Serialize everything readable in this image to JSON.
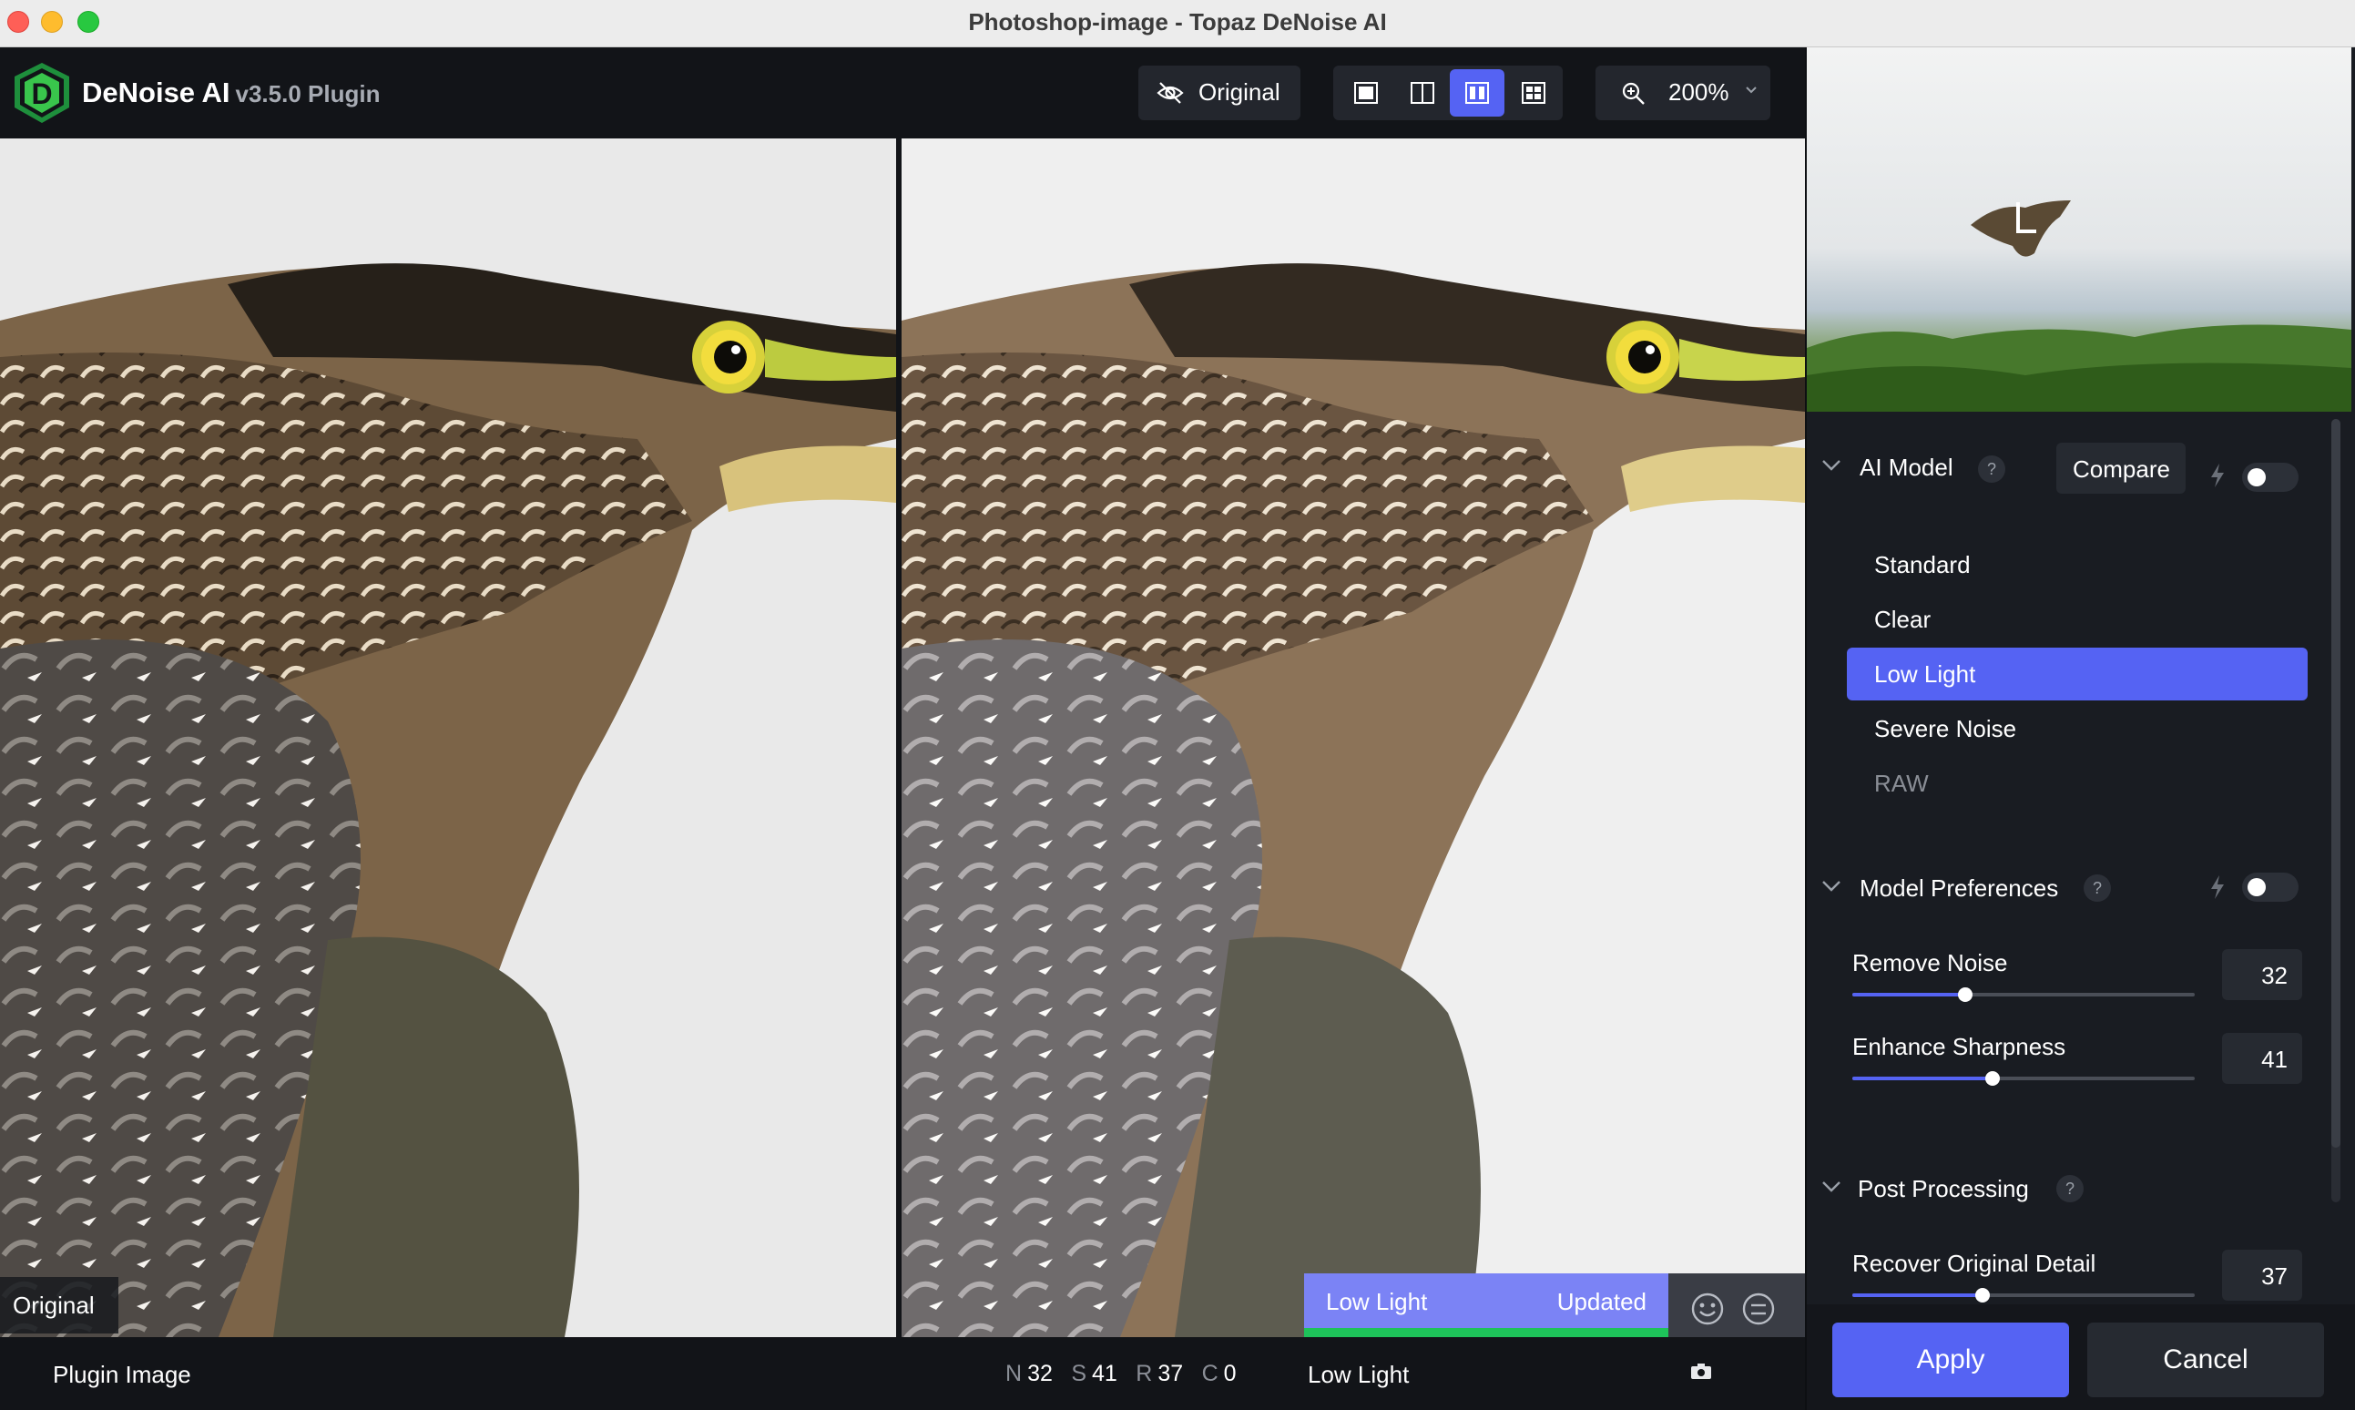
{
  "window": {
    "title": "Photoshop-image - Topaz DeNoise AI"
  },
  "app": {
    "name": "DeNoise AI",
    "version": "v3.5.0 Plugin"
  },
  "toolbar": {
    "original_label": "Original",
    "zoom_label": "200%",
    "view_modes": [
      "single-view",
      "split-view",
      "side-by-side-view",
      "comparison-grid-view"
    ],
    "active_view": "side-by-side-view"
  },
  "preview": {
    "original_tag": "Original",
    "model_name": "Low Light",
    "model_state": "Updated"
  },
  "statusbar": {
    "plugin_image": "Plugin Image",
    "stats": [
      {
        "key": "N",
        "value": "32"
      },
      {
        "key": "S",
        "value": "41"
      },
      {
        "key": "R",
        "value": "37"
      },
      {
        "key": "C",
        "value": "0"
      }
    ],
    "model": "Low Light"
  },
  "ai_model": {
    "title": "AI Model",
    "help": "?",
    "compare_label": "Compare",
    "items": [
      {
        "label": "Standard",
        "state": "normal"
      },
      {
        "label": "Clear",
        "state": "normal"
      },
      {
        "label": "Low Light",
        "state": "selected"
      },
      {
        "label": "Severe Noise",
        "state": "normal"
      },
      {
        "label": "RAW",
        "state": "disabled"
      }
    ]
  },
  "model_preferences": {
    "title": "Model Preferences",
    "help": "?",
    "remove_noise": {
      "label": "Remove Noise",
      "value": "32",
      "fraction": 0.33
    },
    "enhance_sharpness": {
      "label": "Enhance Sharpness",
      "value": "41",
      "fraction": 0.41
    }
  },
  "post_processing": {
    "title": "Post Processing",
    "help": "?",
    "recover_detail": {
      "label": "Recover Original Detail",
      "value": "37",
      "fraction": 0.38
    }
  },
  "actions": {
    "apply": "Apply",
    "cancel": "Cancel"
  },
  "colors": {
    "accent": "#5563f3",
    "status_green": "#1ec35a",
    "panel": "#191c22"
  }
}
